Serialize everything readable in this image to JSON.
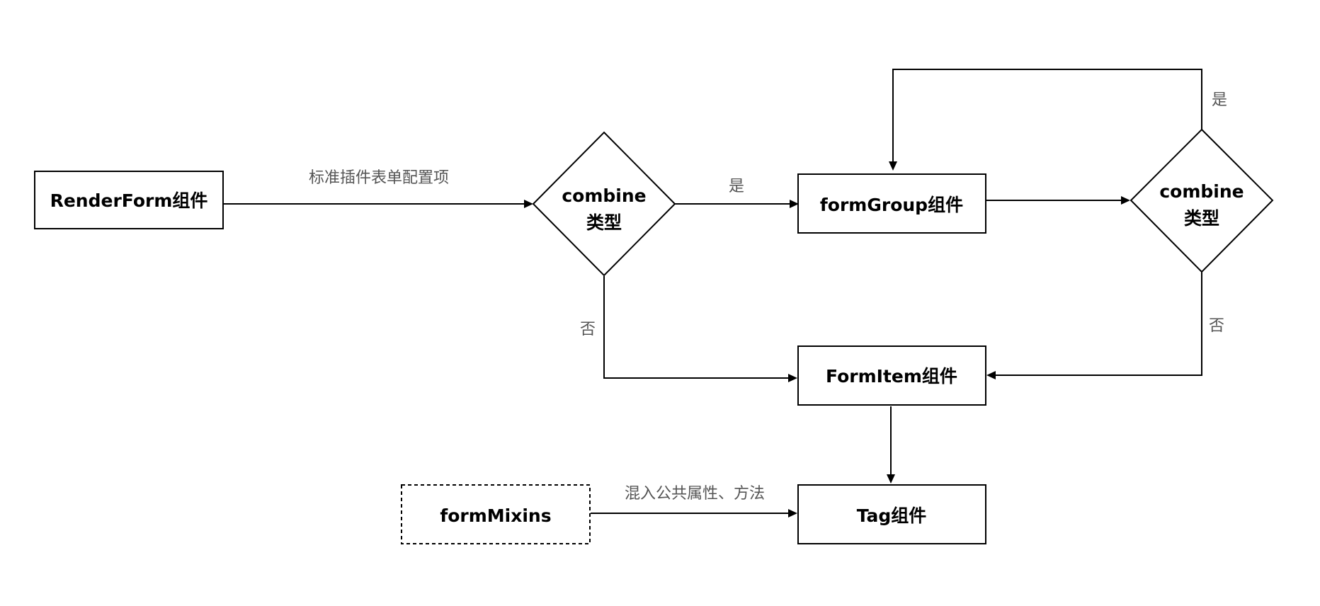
{
  "nodes": {
    "renderform": "RenderForm组件",
    "combine_left_line1": "combine",
    "combine_left_line2": "类型",
    "formgroup": "formGroup组件",
    "combine_right_line1": "combine",
    "combine_right_line2": "类型",
    "formitem": "FormItem组件",
    "tag": "Tag组件",
    "formmixins": "formMixins"
  },
  "edges": {
    "config_items": "标准插件表单配置项",
    "left_yes": "是",
    "left_no": "否",
    "right_yes": "是",
    "right_no": "否",
    "mixins": "混入公共属性、方法"
  },
  "colors": {
    "stroke": "#000000",
    "edge_text": "#555555",
    "background": "#ffffff"
  }
}
